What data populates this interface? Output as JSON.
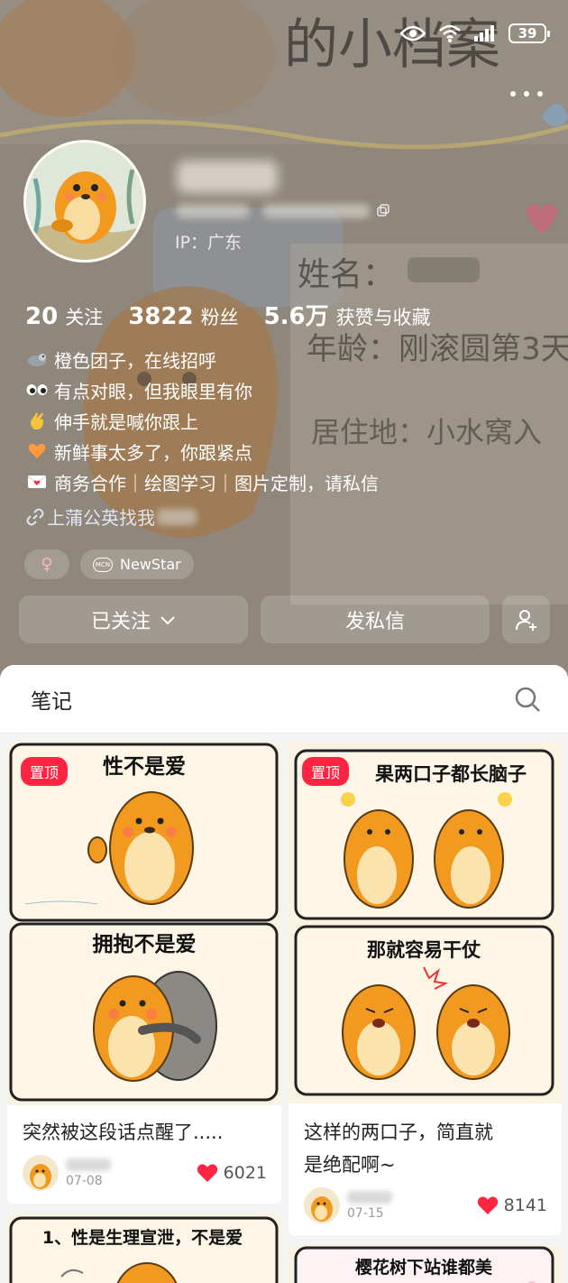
{
  "status_bar": {
    "battery": "39"
  },
  "profile": {
    "ip_label": "IP：广东",
    "stats": [
      {
        "num": "20",
        "label": "关注"
      },
      {
        "num": "3822",
        "label": "粉丝"
      },
      {
        "num": "5.6万",
        "label": "获赞与收藏"
      }
    ],
    "bio": [
      {
        "icon": "seal-emoji-icon",
        "text": "橙色团子，在线招呼"
      },
      {
        "icon": "eyes-emoji-icon",
        "text": "有点对眼，但我眼里有你"
      },
      {
        "icon": "wave-emoji-icon",
        "text": "伸手就是喊你跟上"
      },
      {
        "icon": "orange-heart-emoji-icon",
        "text": "新鲜事太多了，你跟紧点"
      },
      {
        "icon": "love-letter-emoji-icon",
        "text": "商务合作｜绘图学习｜图片定制，请私信"
      }
    ],
    "link_text": "上蒲公英找我",
    "gender_symbol": "♀",
    "mcn_badge": "MCN",
    "mcn_tag": "NewStar",
    "follow_button": "已关注",
    "message_button": "发私信",
    "background_art_text": [
      "的小档案",
      "姓名：",
      "年龄：刚滚圆第3天",
      "居住地：小水窝入"
    ]
  },
  "notes": {
    "tab_label": "笔记",
    "pin_label": "置顶",
    "cards": [
      {
        "panels": [
          "性不是爱",
          "拥抱不是爱"
        ],
        "pinned": true,
        "title_lines": [
          "突然被这段话点醒了....."
        ],
        "date": "07-08",
        "likes": "6021"
      },
      {
        "panels": [
          "果两口子都长脑子",
          "那就容易干仗"
        ],
        "pinned": true,
        "title_lines": [
          "这样的两口子，简直就",
          "是绝配啊~"
        ],
        "date": "07-15",
        "likes": "8141"
      },
      {
        "panels": [
          "1、性是生理宣泄，不是爱"
        ],
        "pinned": false
      },
      {
        "panels": [
          "樱花树下站谁都美"
        ],
        "pinned": false
      }
    ]
  },
  "colors": {
    "accent": "#ff2442",
    "seal_orange": "#f29a1f",
    "header_tint": "#8d8479"
  }
}
